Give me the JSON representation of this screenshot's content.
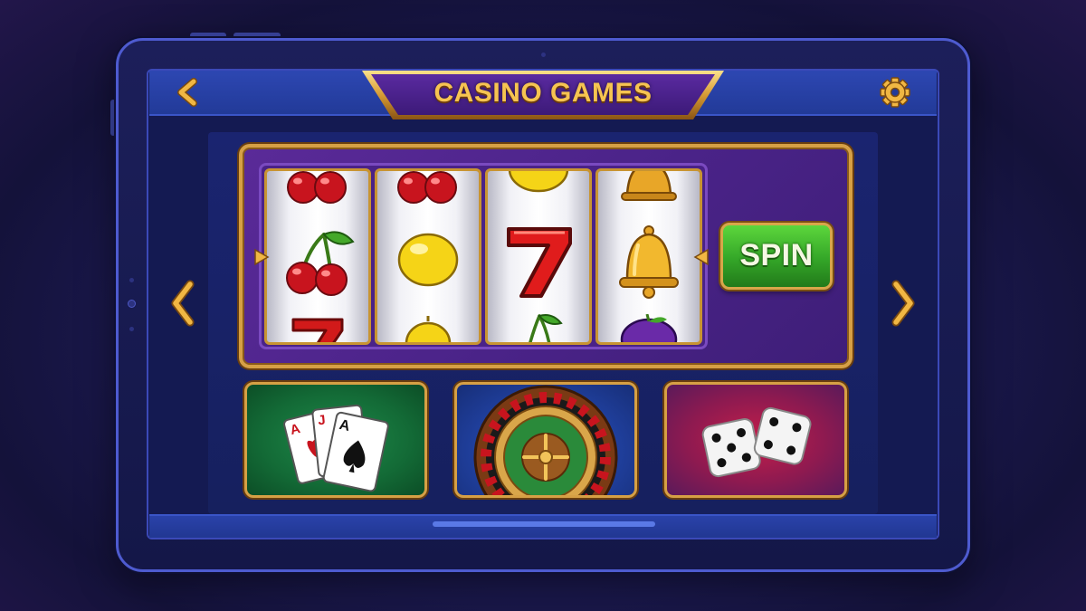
{
  "header": {
    "title": "CASINO GAMES",
    "back_icon": "chevron-left-icon",
    "settings_icon": "gear-icon"
  },
  "slot_machine": {
    "spin_label": "SPIN",
    "reels": [
      {
        "top": "cherry",
        "center": "cherry",
        "bottom": "seven"
      },
      {
        "top": "cherry",
        "center": "lemon",
        "bottom": "lemon"
      },
      {
        "top": "lemon",
        "center": "seven",
        "bottom": "cherry"
      },
      {
        "top": "bell",
        "center": "bell",
        "bottom": "plum"
      }
    ]
  },
  "navigation": {
    "prev_icon": "chevron-left-icon",
    "next_icon": "chevron-right-icon"
  },
  "games": [
    {
      "name": "cards",
      "icon": "playing-cards-icon",
      "cards": [
        "A",
        "J",
        "A"
      ]
    },
    {
      "name": "roulette",
      "icon": "roulette-wheel-icon"
    },
    {
      "name": "dice",
      "icon": "dice-icon"
    }
  ],
  "colors": {
    "gold": "#d6a045",
    "title_gold": "#f6c451",
    "spin_green": "#34a628",
    "slot_purple": "#4a2388",
    "screen_blue": "#223a98"
  }
}
